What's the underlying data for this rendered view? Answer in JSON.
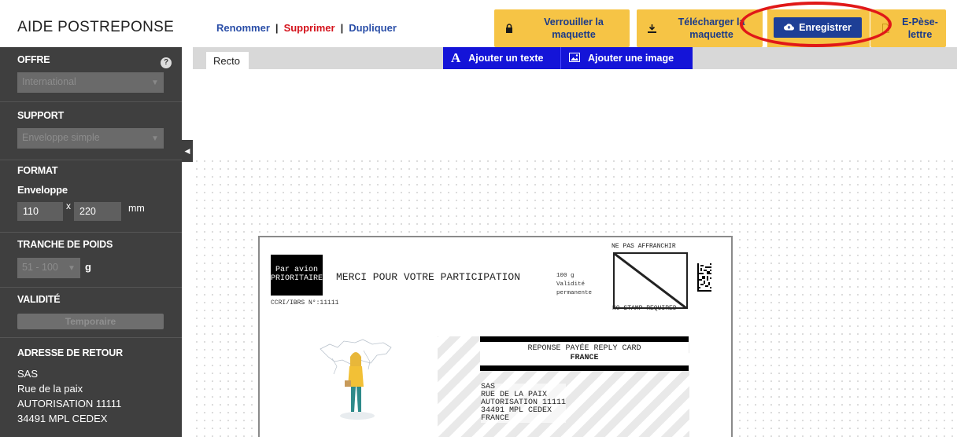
{
  "header": {
    "app_title": "AIDE POSTREPONSE",
    "links": {
      "rename": "Renommer",
      "delete": "Supprimer",
      "duplicate": "Dupliquer",
      "separator": "|"
    },
    "buttons": {
      "lock_line1": "Verrouiller la",
      "lock_line2": "maquette",
      "download_line1": "Télécharger la",
      "download_line2": "maquette",
      "save": "Enregistrer",
      "pese_line1": "E-Pèse-",
      "pese_line2": "lettre"
    }
  },
  "sidebar": {
    "offre": {
      "label": "OFFRE",
      "value": "International",
      "help": "?"
    },
    "support": {
      "label": "SUPPORT",
      "value": "Enveloppe simple"
    },
    "format": {
      "label": "FORMAT",
      "type": "Enveloppe",
      "width": "110",
      "times": "x",
      "height": "220",
      "unit": "mm"
    },
    "poids": {
      "label": "TRANCHE DE POIDS",
      "value": "51 - 100",
      "unit": "g"
    },
    "validite": {
      "label": "VALIDITÉ",
      "button": "Temporaire"
    },
    "adresse": {
      "label": "ADRESSE DE RETOUR",
      "lines": [
        "SAS",
        "Rue de la paix",
        "AUTORISATION 11111",
        "34491 MPL CEDEX"
      ]
    }
  },
  "canvas": {
    "tab": "Recto",
    "add_text": "Ajouter un texte",
    "add_image": "Ajouter une image",
    "card": {
      "par_avion_1": "Par avion",
      "par_avion_2": "PRIORITAIRE",
      "merci": "MERCI POUR VOTRE PARTICIPATION",
      "ccri": "CCRI/IBRS N°:11111",
      "info_weight": "100 g",
      "info_validite": "Validité",
      "info_permanente": "permanente",
      "stamp_top": "NE PAS AFFRANCHIR",
      "stamp_bottom": "NO STAMP REQUIRED",
      "reponse": "REPONSE PAYÉE REPLY CARD",
      "country": "FRANCE",
      "addr": [
        "SAS",
        "RUE DE LA PAIX",
        "AUTORISATION 11111",
        "34491 MPL CEDEX",
        "FRANCE"
      ]
    }
  },
  "colors": {
    "accent_yellow": "#f6c445",
    "accent_blue": "#1e3f96",
    "tool_blue": "#1414d8",
    "link_red": "#d4121b",
    "sidebar_bg": "#3f3f3f"
  }
}
